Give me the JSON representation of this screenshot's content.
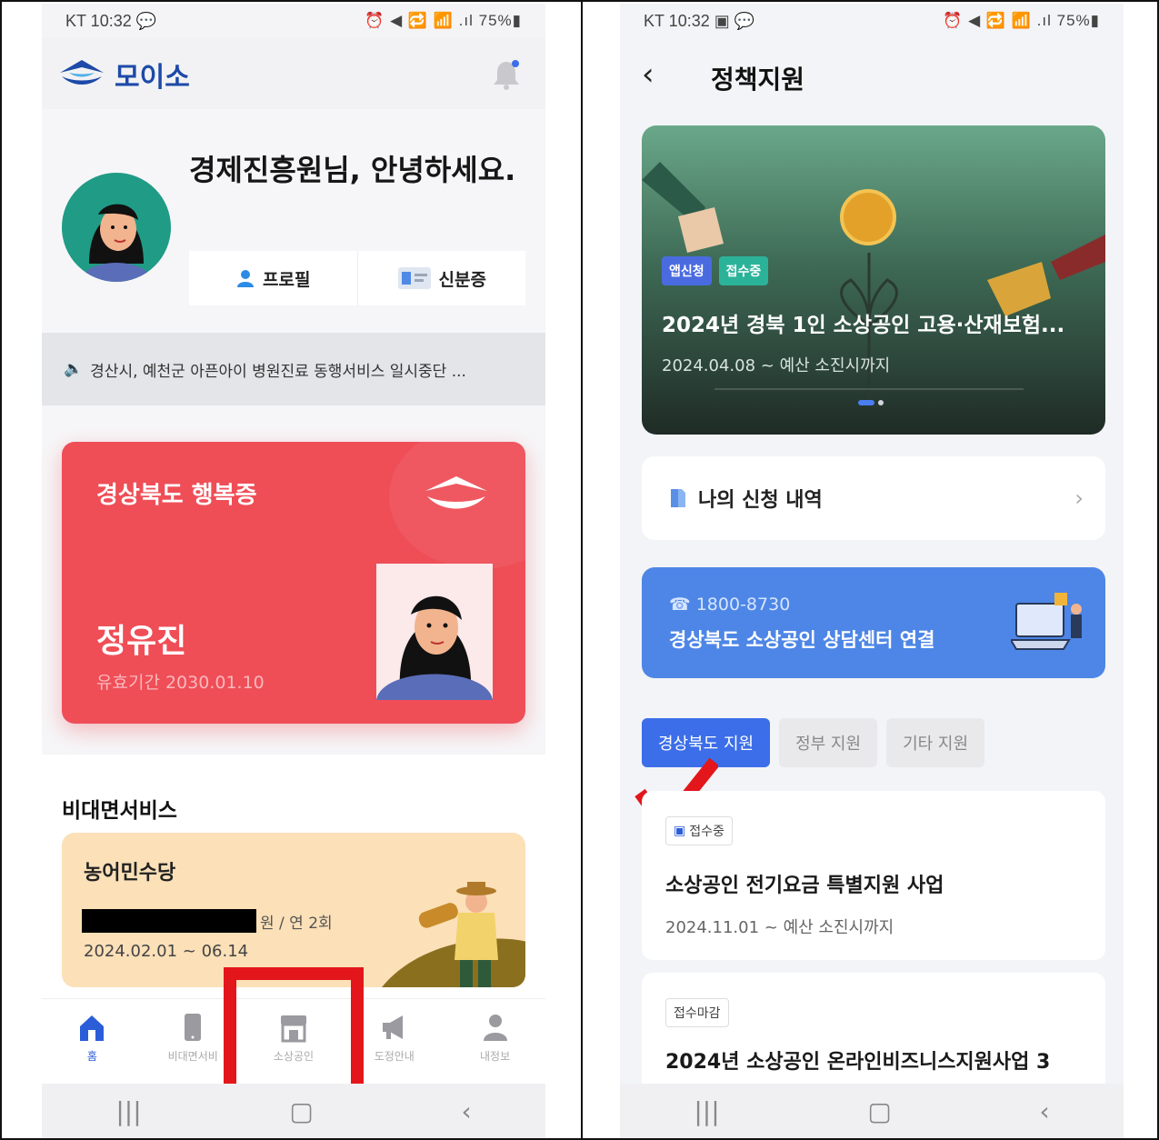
{
  "left": {
    "status_left": "KT 10:32 💬",
    "status_right": "⏰ ◀ 🔁 📶 .ıl 75%▮",
    "app_name": "모이소",
    "greeting": "경제진흥원님, 안녕하세요.",
    "btn_profile": "프로필",
    "btn_id": "신분증",
    "notice": "경산시, 예천군 아픈아이 병원진료 동행서비스 일시중단 ...",
    "card_title": "경상북도 행복증",
    "card_name": "정유진",
    "card_valid": "유효기간 2030.01.10",
    "svc_heading": "비대면서비스",
    "svc_name": "농어민수당",
    "svc_amount_suffix": "원 / 연 2회",
    "svc_period": "2024.02.01 ~ 06.14",
    "nav": [
      {
        "label": "홈"
      },
      {
        "label": "비대면서비"
      },
      {
        "label": "소상공인"
      },
      {
        "label": "도정안내"
      },
      {
        "label": "내정보"
      }
    ]
  },
  "right": {
    "status_left": "KT 10:32 ▣ 💬",
    "status_right": "⏰ ◀ 🔁 📶 .ıl 75%▮",
    "title": "정책지원",
    "banner": {
      "badge1": "앱신청",
      "badge2": "접수중",
      "title": "2024년 경북 1인 소상공인 고용·산재보험...",
      "date": "2024.04.08 ~ 예산 소진시까지"
    },
    "my_apps": "나의 신청 내역",
    "call_number": "1800-8730",
    "call_text": "경상북도 소상공인 상담센터 연결",
    "tabs": [
      "경상북도 지원",
      "정부 지원",
      "기타 지원"
    ],
    "cards": [
      {
        "status": "접수중",
        "title": "소상공인 전기요금 특별지원 사업",
        "date": "2024.11.01 ~ 예산 소진시까지"
      },
      {
        "status": "접수마감",
        "title": "2024년 소상공인 온라인비즈니스지원사업 3"
      }
    ]
  },
  "colors": {
    "brand_blue": "#1d4aa8",
    "card_red": "#ef4e57",
    "call_blue": "#4d86e6",
    "annotation_red": "#e3161b"
  }
}
